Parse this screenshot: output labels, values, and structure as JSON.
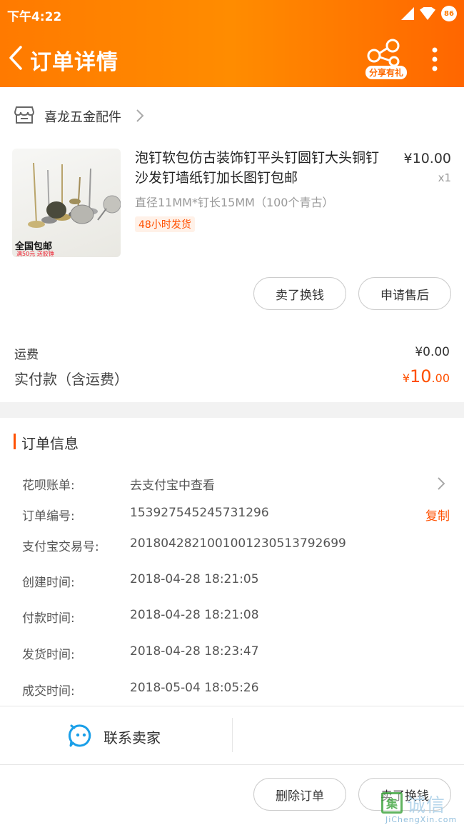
{
  "status": {
    "time": "下午4:22",
    "battery": "86"
  },
  "header": {
    "title": "订单详情",
    "share_badge": "分享有礼"
  },
  "shop": {
    "name": "喜龙五金配件"
  },
  "product": {
    "title": "泡钉软包仿古装饰钉平头钉圆钉大头铜钉沙发钉墙纸钉加长图钉包邮",
    "sku": "直径11MM*钉长15MM（100个青古）",
    "tag": "48小时发货",
    "price": "¥10.00",
    "qty": "x1",
    "image_label": "全国包邮",
    "image_sub": "满50元 送胶锤"
  },
  "item_actions": {
    "sell": "卖了换钱",
    "after_sale": "申请售后"
  },
  "totals": {
    "shipping_label": "运费",
    "shipping_value": "¥0.00",
    "paid_label": "实付款（含运费）",
    "paid_currency": "¥",
    "paid_int": "10",
    "paid_dec": ".00"
  },
  "order_info": {
    "title": "订单信息",
    "huabei_label": "花呗账单:",
    "huabei_value": "去支付宝中查看",
    "order_no_label": "订单编号:",
    "order_no": "153927545245731296",
    "copy_label": "复制",
    "alipay_no_label": "支付宝交易号:",
    "alipay_no": "2018042821001001230513792699",
    "created_label": "创建时间:",
    "created": "2018-04-28 18:21:05",
    "paid_label": "付款时间:",
    "paid": "2018-04-28 18:21:08",
    "shipped_label": "发货时间:",
    "shipped": "2018-04-28 18:23:47",
    "done_label": "成交时间:",
    "done": "2018-05-04 18:05:26"
  },
  "contact": {
    "label": "联系卖家"
  },
  "bottom_actions": {
    "delete": "删除订单",
    "sell": "卖了换钱"
  },
  "watermark": {
    "text": "诚信",
    "sub": "JiChengXin.com"
  },
  "colors": {
    "accent": "#ff5000",
    "header_start": "#ff7a00",
    "header_end": "#ff6600",
    "contact_icon": "#1a9fe8"
  }
}
